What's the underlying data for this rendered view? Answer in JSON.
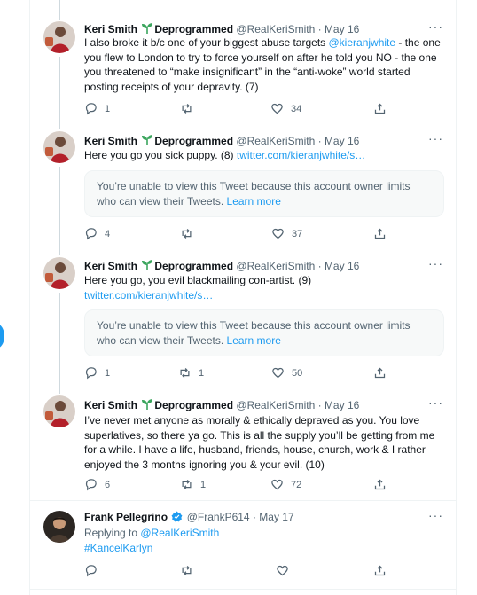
{
  "tweets": [
    {
      "name": "Keri Smith",
      "name_suffix": "Deprogrammed",
      "handle": "@RealKeriSmith",
      "date": "· May 16",
      "text_parts": [
        "I also broke it b/c one of your biggest abuse targets ",
        "@kieranjwhite",
        " - the one you flew to London to try to force yourself on after he told you NO - the one you threatened to “make insignificant” in the “anti-woke” world started posting receipts of your depravity. (7)"
      ],
      "replies": "1",
      "retweets": "",
      "likes": "34"
    },
    {
      "name": "Keri Smith",
      "name_suffix": "Deprogrammed",
      "handle": "@RealKeriSmith",
      "date": "· May 16",
      "text_parts": [
        "Here you go you sick puppy. (8) ",
        "twitter.com/kieranjwhite/s…"
      ],
      "blocked_text": "You’re unable to view this Tweet because this account owner limits who can view their Tweets.",
      "blocked_link": "Learn more",
      "replies": "4",
      "retweets": "",
      "likes": "37"
    },
    {
      "name": "Keri Smith",
      "name_suffix": "Deprogrammed",
      "handle": "@RealKeriSmith",
      "date": "· May 16",
      "text_parts": [
        "Here you go, you evil blackmailing con-artist. (9)",
        "twitter.com/kieranjwhite/s…"
      ],
      "blocked_text": "You’re unable to view this Tweet because this account owner limits who can view their Tweets.",
      "blocked_link": "Learn more",
      "replies": "1",
      "retweets": "1",
      "likes": "50"
    },
    {
      "name": "Keri Smith",
      "name_suffix": "Deprogrammed",
      "handle": "@RealKeriSmith",
      "date": "· May 16",
      "text": "I’ve never met anyone as morally & ethically depraved as you. You love superlatives, so there ya go. This is all the supply you’ll be getting from me for a while. I have a life, husband, friends, house, church, work & I rather enjoyed the 3 months ignoring you & your evil. (10)",
      "replies": "6",
      "retweets": "1",
      "likes": "72"
    },
    {
      "name": "Frank Pellegrino",
      "handle": "@FrankP614",
      "date": "· May 17",
      "replying_label": "Replying to ",
      "replying_to": "@RealKeriSmith",
      "hashtag": "#KancelKarlyn",
      "replies": "",
      "retweets": "",
      "likes": ""
    }
  ],
  "more_label": "···",
  "colors": {
    "link": "#1d9bf0",
    "secondary": "#536471",
    "sprout": "#3ba55d"
  }
}
